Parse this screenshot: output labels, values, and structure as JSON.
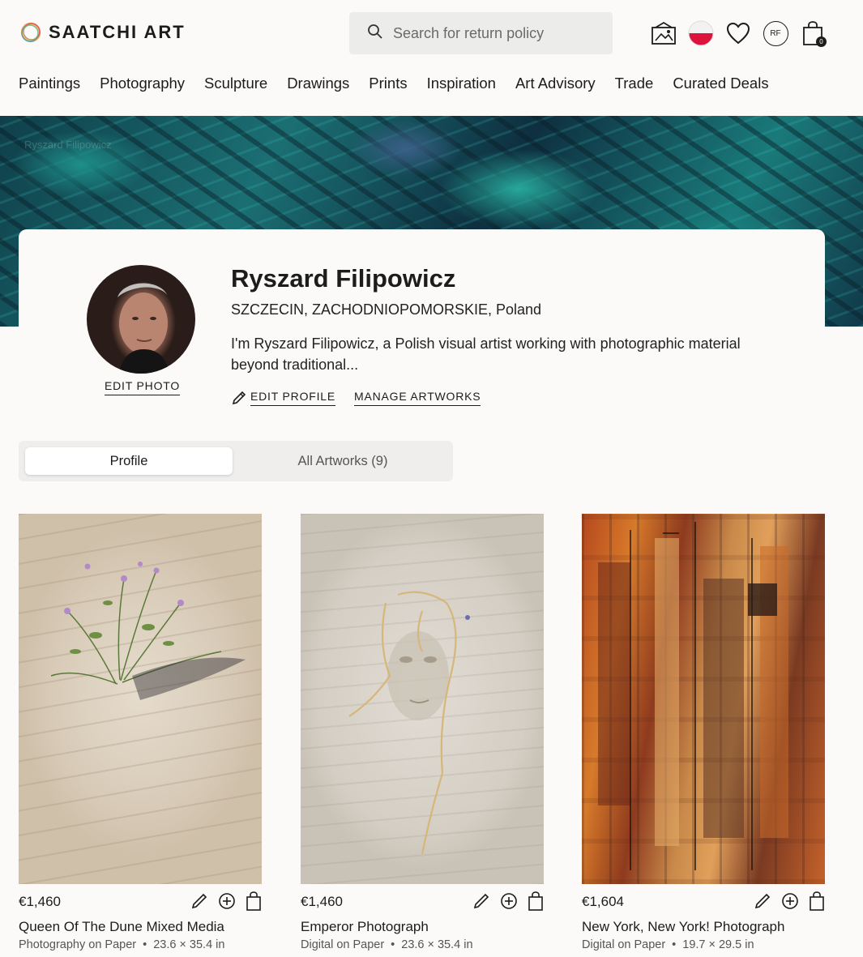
{
  "header": {
    "logo_text": "SAATCHI ART",
    "search_placeholder": "Search for return policy",
    "user_initials": "RF",
    "cart_count": "0",
    "nav": [
      "Paintings",
      "Photography",
      "Sculpture",
      "Drawings",
      "Prints",
      "Inspiration",
      "Art Advisory",
      "Trade",
      "Curated Deals"
    ]
  },
  "banner": {
    "breadcrumb": "Ryszard Filipowicz"
  },
  "profile": {
    "name": "Ryszard Filipowicz",
    "location": "SZCZECIN, ZACHODNIOPOMORSKIE, Poland",
    "bio": "I'm Ryszard Filipowicz, a Polish visual artist working with photographic material beyond traditional...",
    "edit_photo": "EDIT PHOTO",
    "edit_profile": "EDIT PROFILE",
    "manage_artworks": "MANAGE ARTWORKS"
  },
  "tabs": {
    "profile": "Profile",
    "all_artworks": "All Artworks (9)"
  },
  "artworks": [
    {
      "price": "€1,460",
      "title": "Queen Of The Dune Mixed Media",
      "medium": "Photography on Paper",
      "size": "23.6 × 35.4 in"
    },
    {
      "price": "€1,460",
      "title": "Emperor Photograph",
      "medium": "Digital on Paper",
      "size": "23.6 × 35.4 in"
    },
    {
      "price": "€1,604",
      "title": "New York, New York! Photograph",
      "medium": "Digital on Paper",
      "size": "19.7 × 29.5 in"
    }
  ],
  "colors": {
    "accent": "#1c1c1c",
    "background": "#fbfaf8",
    "search_bg": "#ececea",
    "poland_red": "#dc143c"
  }
}
